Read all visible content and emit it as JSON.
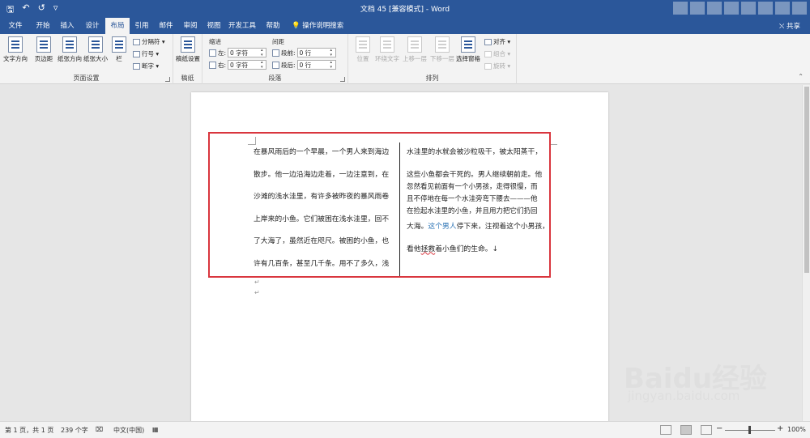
{
  "title_bar": {
    "title": "文档 45 [兼容模式] - Word",
    "qat": {
      "save": "🖫",
      "undo": "↶",
      "redo": "↺",
      "customize": "▿"
    }
  },
  "tabs": [
    {
      "label": "文件"
    },
    {
      "label": "开始"
    },
    {
      "label": "插入"
    },
    {
      "label": "设计"
    },
    {
      "label": "布局",
      "active": true
    },
    {
      "label": "引用"
    },
    {
      "label": "邮件"
    },
    {
      "label": "审阅"
    },
    {
      "label": "视图"
    },
    {
      "label": "开发工具"
    },
    {
      "label": "帮助"
    }
  ],
  "tell_me": "操作说明搜索",
  "share": "共享",
  "ribbon": {
    "page_setup": {
      "label": "页面设置",
      "text_direction": "文字方向",
      "margins": "页边距",
      "orientation": "纸张方向",
      "size": "纸张大小",
      "columns": "栏",
      "breaks": "分隔符 ▾",
      "line_numbers": "行号 ▾",
      "hyphenation": "断字 ▾"
    },
    "manuscript": {
      "label": "稿纸",
      "button": "稿纸设置"
    },
    "paragraph": {
      "label": "段落",
      "indent_title": "缩进",
      "spacing_title": "间距",
      "left_label": "左:",
      "left_value": "0 字符",
      "right_label": "右:",
      "right_value": "0 字符",
      "before_label": "段前:",
      "before_value": "0 行",
      "after_label": "段后:",
      "after_value": "0 行"
    },
    "arrange": {
      "label": "排列",
      "position": "位置",
      "wrap": "环绕文字",
      "forward": "上移一层",
      "backward": "下移一层",
      "selection_pane": "选择窗格",
      "align": "对齐 ▾",
      "group": "组合 ▾",
      "rotate": "旋转 ▾"
    }
  },
  "document": {
    "left_column": [
      "在暴风雨后的一个早晨，一个男人来到海边",
      "散步。他一边沿海边走着，一边注意到，在",
      "沙滩的浅水洼里，有许多被昨夜的暴风雨卷",
      "上岸来的小鱼。它们被困在浅水洼里，回不",
      "了大海了，虽然近在咫尺。被困的小鱼，也",
      "许有几百条，甚至几千条。用不了多久，浅"
    ],
    "right_column": {
      "line1": "水洼里的水就会被沙粒吸干，被太阳蒸干，",
      "line2": "这些小鱼都会干死的。男人继续朝前走。他",
      "line3": "忽然看见前面有一个小男孩，走得很慢，而",
      "line4": "且不停地在每一个水洼旁弯下腰去———他",
      "line5": "在捡起水洼里的小鱼，并且用力把它们扔回",
      "line6_a": "大海。",
      "line6_b": "这个男人",
      "line6_c": "停下来，注视着这个小男孩，",
      "line7_a": "看他",
      "line7_b": "拯救",
      "line7_c": "着小鱼们的生命。↓"
    },
    "paragraph_mark": "↵"
  },
  "status_bar": {
    "page": "第 1 页，共 1 页",
    "words": "239 个字",
    "language": "中文(中国)",
    "zoom_minus": "−",
    "zoom_plus": "+",
    "zoom": "100%"
  },
  "watermark": {
    "text": "Baidu经验",
    "url": "jingyan.baidu.com"
  }
}
